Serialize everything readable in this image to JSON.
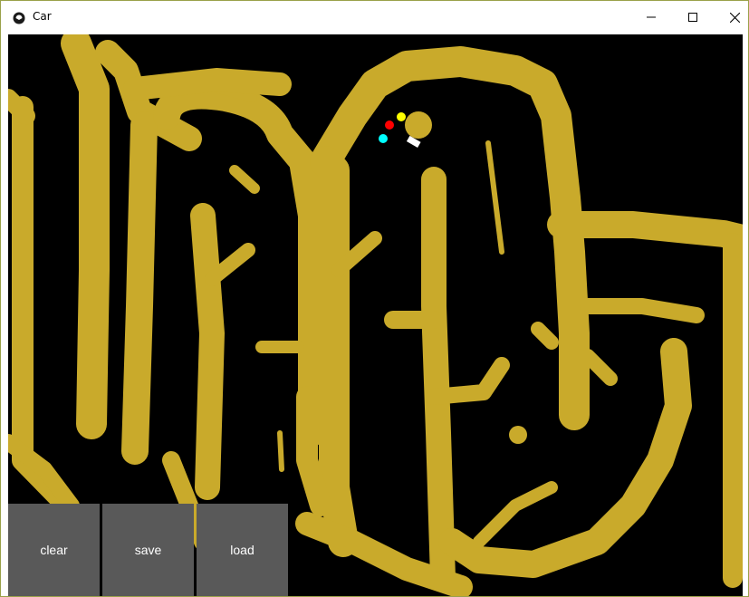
{
  "window": {
    "title": "Car",
    "controls": {
      "minimize_icon": "minimize-icon",
      "maximize_icon": "maximize-icon",
      "close_icon": "close-icon"
    }
  },
  "canvas": {
    "background_color": "#000000",
    "sand_color": "#c9aa2b",
    "car_color": "#c9aa2b",
    "sensor_colors": [
      "#ff0000",
      "#ffff00",
      "#00ffff"
    ]
  },
  "toolbar": {
    "clear_label": "clear",
    "save_label": "save",
    "load_label": "load",
    "button_color": "#595959"
  }
}
